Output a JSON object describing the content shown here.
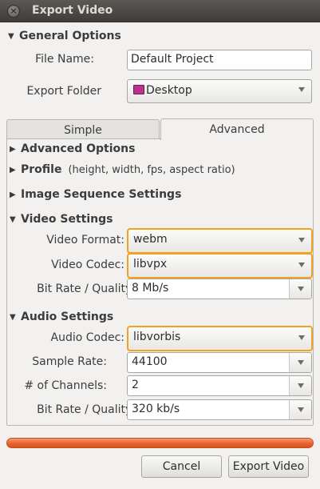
{
  "window": {
    "title": "Export Video",
    "close_symbol": "×"
  },
  "general": {
    "header": "General Options",
    "file_name_label": "File Name:",
    "file_name_value": "Default Project",
    "export_folder_label": "Export Folder",
    "export_folder_value": "Desktop"
  },
  "tabs": {
    "simple": "Simple",
    "advanced": "Advanced",
    "selected": "Advanced"
  },
  "advanced": {
    "advanced_options": "Advanced Options",
    "profile": "Profile",
    "profile_hint": "(height, width, fps, aspect ratio)",
    "image_sequence": "Image Sequence Settings"
  },
  "video": {
    "header": "Video Settings",
    "format_label": "Video Format:",
    "format_value": "webm",
    "codec_label": "Video Codec:",
    "codec_value": "libvpx",
    "bitrate_label": "Bit Rate / Quality:",
    "bitrate_value": "8 Mb/s"
  },
  "audio": {
    "header": "Audio Settings",
    "codec_label": "Audio Codec:",
    "codec_value": "libvorbis",
    "sample_rate_label": "Sample Rate:",
    "sample_rate_value": "44100",
    "channels_label": "# of Channels:",
    "channels_value": "2",
    "bitrate_label": "Bit Rate / Quality:",
    "bitrate_value": "320 kb/s"
  },
  "progress": {
    "fraction": 1.0
  },
  "buttons": {
    "cancel": "Cancel",
    "export": "Export Video"
  },
  "colors": {
    "highlight": "#f0a31f",
    "progress": "#e9632f",
    "titlebar": "#3f3e3a"
  }
}
